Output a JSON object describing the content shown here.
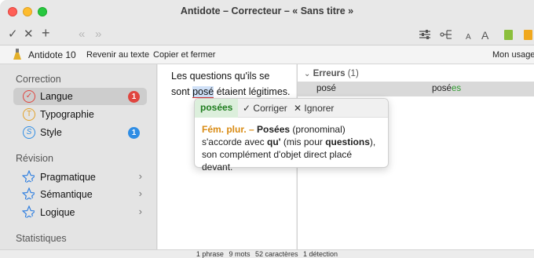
{
  "window": {
    "title": "Antidote – Correcteur – « Sans titre »"
  },
  "toolbar": {
    "check_icon": "✓",
    "close_icon": "✕",
    "add_icon": "+",
    "prev_icon": "«",
    "next_icon": "»",
    "font_small": "A",
    "font_large": "A"
  },
  "subbar": {
    "app_name": "Antidote 10",
    "back_label": "Revenir au texte",
    "copy_label": "Copier et fermer",
    "usage_label": "Mon usage"
  },
  "sidebar": {
    "correction_title": "Correction",
    "items": [
      {
        "label": "Langue",
        "icon_glyph": "✓",
        "badge": "1",
        "badge_color": "#e0453f"
      },
      {
        "label": "Typographie",
        "icon_glyph": "T"
      },
      {
        "label": "Style",
        "icon_glyph": "S",
        "badge": "1",
        "badge_color": "#2f8de4"
      }
    ],
    "revision_title": "Révision",
    "revision_items": [
      {
        "label": "Pragmatique"
      },
      {
        "label": "Sémantique"
      },
      {
        "label": "Logique"
      }
    ],
    "stats_title": "Statistiques"
  },
  "editor": {
    "line1": "Les questions qu'ils se",
    "line2_before": "sont ",
    "error_word": "posé",
    "line2_after": " étaient légitimes."
  },
  "results": {
    "header": "Erreurs",
    "count": "(1)",
    "original": "posé",
    "correction_stem": "posé",
    "correction_ending": "es"
  },
  "popover": {
    "suggestion": "posées",
    "correct_label": "Corriger",
    "ignore_label": "Ignorer",
    "rule": "Fém. plur. –",
    "strong_word": "Posées",
    "text_1": " (pronominal) s'accorde avec ",
    "qu": "qu'",
    "text_2": " (mis pour ",
    "questions": "questions",
    "text_3": "), son complément d'objet direct placé devant."
  },
  "status": {
    "phrases": "1 phrase",
    "words": "9 mots",
    "chars": "52 caractères",
    "detections": "1 détection"
  },
  "colors": {
    "accent_green": "#2e9a2e",
    "error_red": "#d62f2f",
    "rule_orange": "#d98b14"
  }
}
